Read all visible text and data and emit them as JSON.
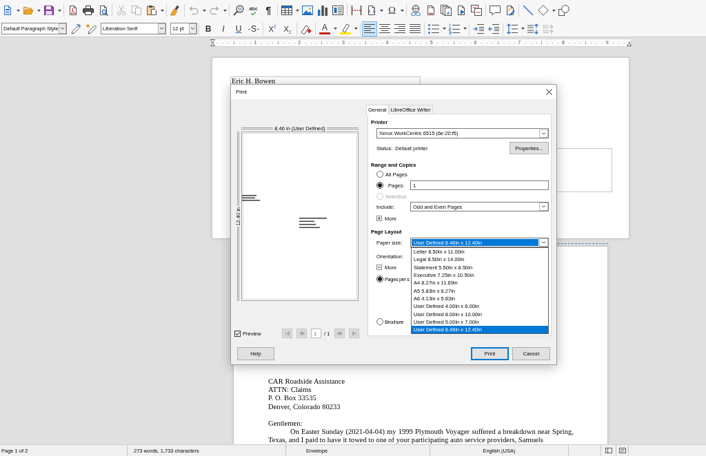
{
  "standard_toolbar": {
    "groups": [
      [
        {
          "kind": "new",
          "dropdown": true,
          "disabled": false
        },
        {
          "kind": "open",
          "dropdown": true,
          "disabled": false
        },
        {
          "kind": "save",
          "dropdown": true,
          "disabled": false
        }
      ],
      [
        {
          "kind": "pdf",
          "dropdown": false,
          "disabled": false
        },
        {
          "kind": "print",
          "dropdown": false,
          "disabled": false
        },
        {
          "kind": "preview",
          "dropdown": false,
          "disabled": false
        }
      ],
      [
        {
          "kind": "cut",
          "dropdown": false,
          "disabled": true
        },
        {
          "kind": "copy",
          "dropdown": false,
          "disabled": true
        },
        {
          "kind": "paste",
          "dropdown": true,
          "disabled": false
        }
      ],
      [
        {
          "kind": "brush",
          "dropdown": false,
          "disabled": false
        }
      ],
      [
        {
          "kind": "undo",
          "dropdown": true,
          "disabled": true
        },
        {
          "kind": "redo",
          "dropdown": true,
          "disabled": true
        }
      ],
      [
        {
          "kind": "find",
          "dropdown": false,
          "disabled": false
        },
        {
          "kind": "spelling",
          "label": "abc",
          "dropdown": false,
          "disabled": false
        },
        {
          "kind": "marks",
          "label": "¶",
          "dropdown": false,
          "disabled": false
        }
      ],
      [
        {
          "kind": "table",
          "dropdown": true,
          "disabled": false
        },
        {
          "kind": "image",
          "dropdown": false,
          "disabled": false
        },
        {
          "kind": "chart",
          "dropdown": false,
          "disabled": false
        },
        {
          "kind": "textbox",
          "dropdown": false,
          "disabled": false
        }
      ],
      [
        {
          "kind": "pagebreak",
          "dropdown": false,
          "disabled": false
        },
        {
          "kind": "field",
          "dropdown": true,
          "disabled": false
        },
        {
          "kind": "special",
          "label": "Ω",
          "dropdown": true,
          "disabled": false
        }
      ],
      [
        {
          "kind": "link",
          "dropdown": false,
          "disabled": false
        },
        {
          "kind": "footnote",
          "dropdown": false,
          "disabled": false
        },
        {
          "kind": "endnote",
          "dropdown": false,
          "disabled": false
        },
        {
          "kind": "bookmark",
          "dropdown": false,
          "disabled": false
        },
        {
          "kind": "crossref",
          "dropdown": false,
          "disabled": false
        }
      ],
      [
        {
          "kind": "comment",
          "dropdown": false,
          "disabled": false
        },
        {
          "kind": "track",
          "dropdown": false,
          "disabled": false
        }
      ],
      [
        {
          "kind": "line",
          "dropdown": false,
          "disabled": false
        },
        {
          "kind": "diamond",
          "dropdown": true,
          "disabled": false
        },
        {
          "kind": "shapes",
          "dropdown": false,
          "disabled": false
        }
      ]
    ]
  },
  "formatting_toolbar": {
    "paragraph_style": "Default Paragraph Style",
    "style_tools": [
      {
        "kind": "update_style",
        "disabled": false
      },
      {
        "kind": "new_style",
        "disabled": false
      }
    ],
    "font_name": "Liberation Serif",
    "font_size": "12 pt",
    "groups": [
      [
        {
          "kind": "bold",
          "label": "B",
          "selected": false,
          "dropdown": false,
          "disabled": false
        },
        {
          "kind": "italic",
          "label": "I",
          "selected": false,
          "dropdown": false,
          "disabled": false
        },
        {
          "kind": "underline",
          "label": "U",
          "selected": false,
          "dropdown": false,
          "disabled": false
        },
        {
          "kind": "strike",
          "label": "S",
          "selected": false,
          "dropdown": false,
          "disabled": false
        }
      ],
      [
        {
          "kind": "superscript",
          "label": "X$^{2}$",
          "selected": false,
          "dropdown": false,
          "disabled": false
        },
        {
          "kind": "subscript",
          "label": "X$_{2}$",
          "selected": false,
          "dropdown": false,
          "disabled": false
        }
      ],
      [
        {
          "kind": "clear",
          "selected": false,
          "dropdown": false,
          "disabled": false
        }
      ],
      [
        {
          "kind": "font_color",
          "label": "A",
          "selected": false,
          "dropdown": true,
          "disabled": false
        },
        {
          "kind": "highlight",
          "selected": false,
          "dropdown": true,
          "disabled": false
        }
      ],
      [
        {
          "kind": "align_left",
          "selected": true,
          "dropdown": false,
          "disabled": false
        },
        {
          "kind": "align_center",
          "selected": false,
          "dropdown": false,
          "disabled": false
        },
        {
          "kind": "align_right",
          "selected": false,
          "dropdown": false,
          "disabled": false
        },
        {
          "kind": "justify",
          "selected": false,
          "dropdown": false,
          "disabled": false
        }
      ],
      [
        {
          "kind": "bullets",
          "selected": false,
          "dropdown": true,
          "disabled": false
        },
        {
          "kind": "numbering",
          "selected": false,
          "dropdown": true,
          "disabled": false
        }
      ],
      [
        {
          "kind": "indent",
          "selected": false,
          "dropdown": false,
          "disabled": false
        },
        {
          "kind": "outdent",
          "selected": false,
          "dropdown": false,
          "disabled": false
        }
      ],
      [
        {
          "kind": "line_spacing",
          "selected": false,
          "dropdown": true,
          "disabled": false
        },
        {
          "kind": "para_space_up",
          "selected": false,
          "dropdown": false,
          "disabled": false
        },
        {
          "kind": "para_space_down",
          "selected": false,
          "dropdown": false,
          "disabled": true
        }
      ]
    ]
  },
  "ruler": {
    "numbers": [
      "1",
      "2",
      "3",
      "4",
      "5",
      "6",
      "7",
      "8",
      "9"
    ]
  },
  "document": {
    "envelope_page": {
      "sender": "Eric H. Bowen"
    },
    "letter_page": {
      "recipient": [
        "CAR Roadside Assistance",
        "ATTN: Claims",
        "P. O. Box 33535",
        "Denver, Colorado 80233"
      ],
      "salutation": "Gentlemen:",
      "body_lines": [
        "On Easter Sunday (2021-04-04) my 1999 Plymouth Voyager suffered a breakdown near Spring,",
        "Texas, and I paid to have it towed to one of your participating auto service providers, Samuels"
      ]
    }
  },
  "status_bar": {
    "page": "Page 1 of 2",
    "word_count": "273 words, 1,733 characters",
    "page_style": "Envelope",
    "language": "English (USA)"
  },
  "print_dialog": {
    "title": "Print",
    "preview": {
      "width_label": "8.46 in (User Defined)",
      "height_label": "12.40 in",
      "show_preview": {
        "label": "Preview",
        "checked": true
      },
      "navigation": [
        {
          "kind": "first",
          "disabled": true
        },
        {
          "kind": "previous",
          "disabled": true
        },
        {
          "kind": "next",
          "disabled": true
        },
        {
          "kind": "last",
          "disabled": true
        }
      ],
      "page_number": "1",
      "page_count": "/ 1"
    },
    "tabs": [
      {
        "label": "General",
        "selected": true
      },
      {
        "label": "LibreOffice Writer",
        "selected": false
      }
    ],
    "printer": {
      "heading": "Printer",
      "name": "Xerox WorkCentre 6515 (6e:20:f5)",
      "status_label": "Status:",
      "status": "Default printer",
      "properties_button": "Properties..."
    },
    "range_and_copies": {
      "heading": "Range and Copies",
      "options": [
        {
          "label": "All Pages",
          "selected": false,
          "disabled": false
        },
        {
          "label": "Pages:",
          "selected": true,
          "disabled": false,
          "value": "1"
        },
        {
          "label": "Selection",
          "selected": false,
          "disabled": true
        }
      ],
      "include_label": "Include:",
      "include_value": "Odd and Even Pages",
      "more": {
        "label": "More",
        "expanded": false
      }
    },
    "page_layout": {
      "heading": "Page Layout",
      "paper_size_label": "Paper size:",
      "paper_size": {
        "value": "User Defined 8.46in x 12.40in",
        "expanded": true,
        "options": [
          {
            "label": "Letter 8.50in x 11.00in",
            "selected": false
          },
          {
            "label": "Legal 8.50in x 14.00in",
            "selected": false
          },
          {
            "label": "Statement 5.50in x 8.50in",
            "selected": false
          },
          {
            "label": "Executive 7.25in x 10.50in",
            "selected": false
          },
          {
            "label": "A4 8.27in x 11.69in",
            "selected": false
          },
          {
            "label": "A5 5.83in x 8.27in",
            "selected": false
          },
          {
            "label": "A6 4.13in x 5.83in",
            "selected": false
          },
          {
            "label": "User Defined 4.00in x 6.00in",
            "selected": false
          },
          {
            "label": "User Defined 8.00in x 10.00in",
            "selected": false
          },
          {
            "label": "User Defined 5.00in x 7.00in",
            "selected": false
          },
          {
            "label": "User Defined 8.46in x 12.40in",
            "selected": true
          }
        ]
      },
      "orientation_label": "Orientation:",
      "more": {
        "label": "More",
        "expanded": true
      },
      "options": [
        {
          "label": "Pages per s",
          "selected": true
        },
        {
          "label": "Brochure",
          "selected": false
        }
      ]
    },
    "buttons": [
      {
        "label": "Help",
        "default": false
      },
      {
        "label": "Print",
        "default": true
      },
      {
        "label": "Cancel",
        "default": false
      }
    ]
  }
}
